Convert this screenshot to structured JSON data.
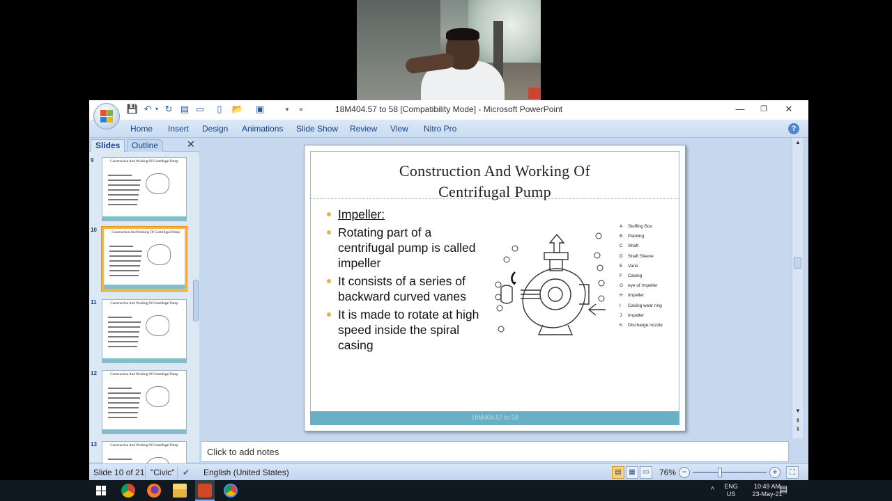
{
  "window": {
    "title": "18M404.57 to 58 [Compatibility Mode] - Microsoft PowerPoint",
    "minimize": "—",
    "restore": "❐",
    "close": "✕"
  },
  "ribbon": {
    "tabs": [
      "Home",
      "Insert",
      "Design",
      "Animations",
      "Slide Show",
      "Review",
      "View",
      "Nitro Pro"
    ],
    "help": "?"
  },
  "pane": {
    "tab_slides": "Slides",
    "tab_outline": "Outline",
    "close": "✕",
    "thumbnails": [
      {
        "number": "9",
        "title": "Construction And Working Of Centrifugal Pump",
        "selected": false
      },
      {
        "number": "10",
        "title": "Construction And Working Of Centrifugal Pump",
        "selected": true
      },
      {
        "number": "11",
        "title": "Construction And Working Of Centrifugal Pump",
        "selected": false
      },
      {
        "number": "12",
        "title": "Construction And Working Of Centrifugal Pump",
        "selected": false
      },
      {
        "number": "13",
        "title": "Construction And Working Of Centrifugal Pump",
        "selected": false
      }
    ]
  },
  "slide": {
    "title_line1": "Construction And Working  Of",
    "title_line2": "Centrifugal Pump",
    "bullets": [
      "Impeller:",
      "Rotating part of a centrifugal pump is called impeller",
      "It consists of a series of backward curved vanes",
      "It is made to rotate at high speed inside the spiral casing"
    ],
    "footer": "18M404.57 to 58",
    "legend": [
      {
        "key": "A",
        "label": "Stuffing Box"
      },
      {
        "key": "B",
        "label": "Packing"
      },
      {
        "key": "C",
        "label": "Shaft"
      },
      {
        "key": "D",
        "label": "Shaft Sleeve"
      },
      {
        "key": "E",
        "label": "Vane"
      },
      {
        "key": "F",
        "label": "Casing"
      },
      {
        "key": "G",
        "label": "eye of Impeller"
      },
      {
        "key": "H",
        "label": "Impeller"
      },
      {
        "key": "I",
        "label": "Casing wear ring"
      },
      {
        "key": "J",
        "label": "Impeller"
      },
      {
        "key": "K",
        "label": "Discharge nozzle"
      }
    ]
  },
  "notes": {
    "placeholder": "Click to add notes"
  },
  "status": {
    "slide_info": "Slide 10 of 21",
    "theme": "\"Civic\"",
    "language": "English (United States)",
    "zoom": "76%"
  },
  "taskbar": {
    "lang": "ENG",
    "region": "US",
    "time": "10:49 AM",
    "date": "23-May-21"
  },
  "colors": {
    "accent": "#15428b",
    "ribbon": "#c9dcf1",
    "slide_bar": "#6ab0c4",
    "selection": "#f7b549"
  }
}
